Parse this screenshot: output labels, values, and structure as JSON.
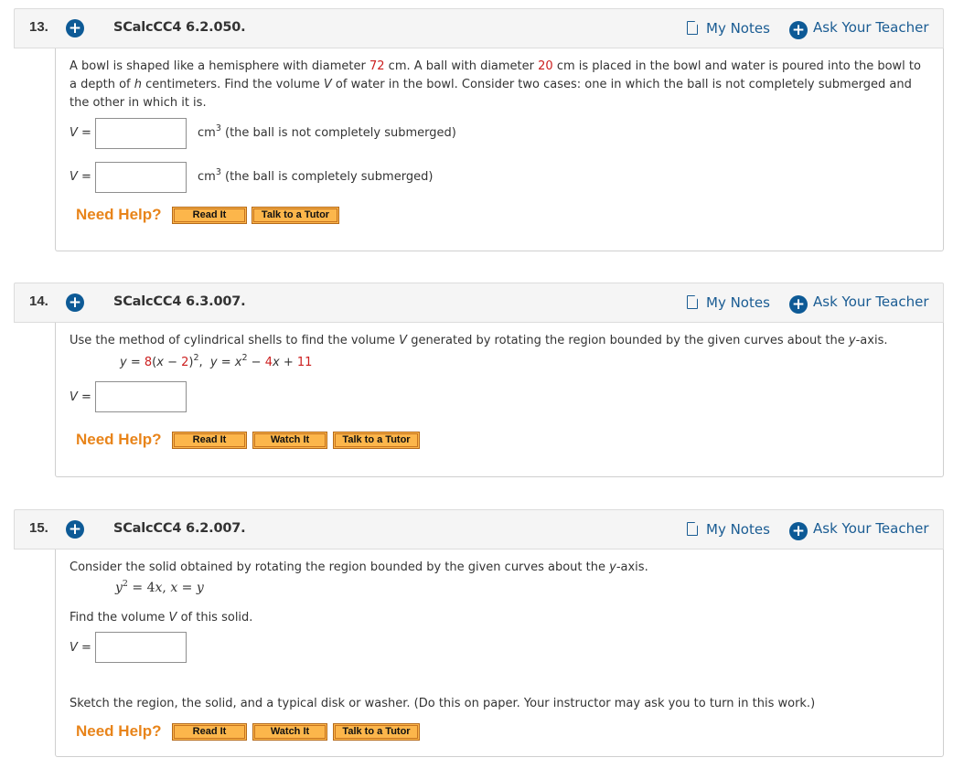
{
  "header_links": {
    "my_notes": "My Notes",
    "ask_teacher": "Ask Your Teacher"
  },
  "questions": [
    {
      "number": "13.",
      "code": "SCalcCC4 6.2.050.",
      "text": {
        "p1": "A bowl is shaped like a hemisphere with diameter ",
        "diameter_bowl": "72",
        "p2": " cm. A ball with diameter ",
        "diameter_ball": "20",
        "p3": " cm is placed in the bowl and water is poured into the bowl to",
        "p4": "a depth of ",
        "h": "h",
        "p5": " centimeters. Find the volume ",
        "v": "V",
        "p6": " of water in the bowl. Consider two cases: one in which the ball is not completely submerged and",
        "p7": "the other in which it is."
      },
      "answers": [
        {
          "label": "V",
          "eq": " =",
          "value": "",
          "unit": "cm",
          "unit_exp": "3",
          "note": " (the ball is not completely submerged)"
        },
        {
          "label": "V",
          "eq": " =",
          "value": "",
          "unit": "cm",
          "unit_exp": "3",
          "note": " (the ball is completely submerged)"
        }
      ],
      "help_label": "Need Help?",
      "help_buttons": [
        "Read It",
        "Talk to a Tutor"
      ]
    },
    {
      "number": "14.",
      "code": "SCalcCC4 6.3.007.",
      "text": {
        "p1": "Use the method of cylindrical shells to find the volume ",
        "v": "V",
        "p2": " generated by rotating the region bounded by the given curves about the ",
        "y": "y",
        "p3": "-axis."
      },
      "equation": {
        "y1": "y",
        "eq1": " = ",
        "c1": "8",
        "open": "(",
        "x1": "x",
        "minus1": " − ",
        "c2": "2",
        "close": ")",
        "exp1": "2",
        "sep": ",  ",
        "y2": "y",
        "eq2": " = ",
        "x2": "x",
        "exp2": "2",
        "minus2": " − ",
        "c3": "4",
        "x3": "x",
        "plus": " + ",
        "c4": "11"
      },
      "answers": [
        {
          "label": "V",
          "eq": " =",
          "value": ""
        }
      ],
      "help_label": "Need Help?",
      "help_buttons": [
        "Read It",
        "Watch It",
        "Talk to a Tutor"
      ]
    },
    {
      "number": "15.",
      "code": "SCalcCC4 6.2.007.",
      "text": {
        "p1": "Consider the solid obtained by rotating the region bounded by the given curves about the ",
        "y": "y",
        "p2": "-axis."
      },
      "equation": {
        "y": "y",
        "exp": "2",
        "rest1": " = 4",
        "x": "x",
        "comma": ", ",
        "x2": "x",
        "eq": " = ",
        "y2": "y"
      },
      "find": {
        "p1": "Find the volume ",
        "v": "V",
        "p2": " of this solid."
      },
      "answers": [
        {
          "label": "V",
          "eq": " =",
          "value": ""
        }
      ],
      "sketch": "Sketch the region, the solid, and a typical disk or washer. (Do this on paper. Your instructor may ask you to turn in this work.)",
      "help_label": "Need Help?",
      "help_buttons": [
        "Read It",
        "Watch It",
        "Talk to a Tutor"
      ]
    }
  ],
  "colors": {
    "link_blue": "#1a5c93",
    "plus_blue": "#0d5a96",
    "need_help_orange": "#e8841a",
    "button_orange": "#fcb64b",
    "value_red": "#cc1f1f"
  }
}
